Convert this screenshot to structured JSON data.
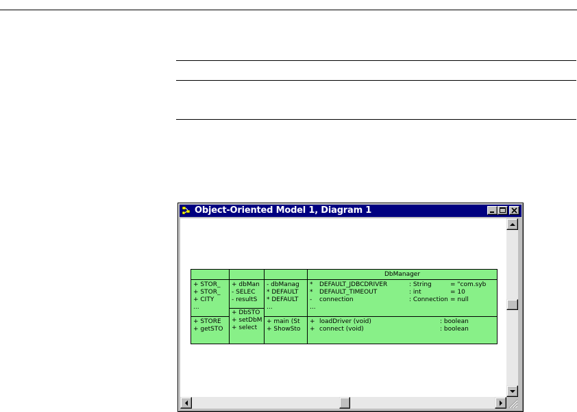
{
  "window": {
    "title": "Object-Oriented Model 1, Diagram 1",
    "controls": [
      "minimize",
      "maximize",
      "close"
    ]
  },
  "colors": {
    "class_fill": "#88f088",
    "titlebar": "#000080"
  },
  "classes": [
    {
      "name": "",
      "attributes": [
        "+  STOR_",
        "+  STOR_",
        "+  CITY",
        "..."
      ],
      "operations": [
        "+  STORE",
        "+  getSTO"
      ]
    },
    {
      "name": "",
      "attributes": [
        "+  dbMan",
        "-   SELEC",
        "-   resultS",
        "+  DbSTO"
      ],
      "operations": [
        "+  setDbM",
        "+  select"
      ]
    },
    {
      "name": "",
      "attributes": [
        "-  dbManag",
        "*  DEFAULT",
        "*  DEFAULT",
        "..."
      ],
      "operations": [
        "+  main (St",
        "+  ShowSto"
      ]
    },
    {
      "name": "DbManager",
      "attributes": [
        {
          "vis": "*",
          "name": "DEFAULT_JDBCDRIVER",
          "type": ": String",
          "init": "= \"com.syb"
        },
        {
          "vis": "*",
          "name": "DEFAULT_TIMEOUT",
          "type": ": int",
          "init": "= 10"
        },
        {
          "vis": "-",
          "name": "connection",
          "type": ": Connection",
          "init": "= null"
        },
        {
          "vis": "...",
          "name": "",
          "type": "",
          "init": ""
        }
      ],
      "operations": [
        {
          "vis": "+",
          "name": "loadDriver (void)",
          "type": ": boolean"
        },
        {
          "vis": "+",
          "name": "connect (void)",
          "type": ": boolean"
        }
      ]
    }
  ]
}
